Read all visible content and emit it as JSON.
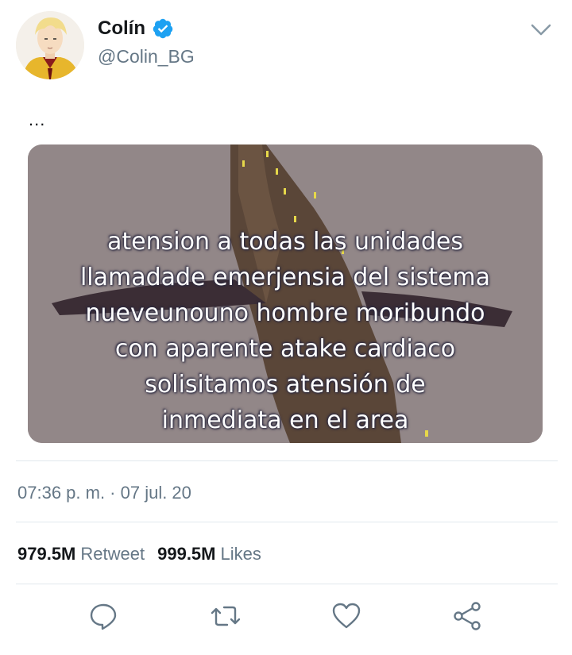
{
  "user": {
    "name": "Colín",
    "handle": "@Colin_BG"
  },
  "tweet": {
    "text": "...",
    "image_caption_lines": [
      "atension a todas las unidades",
      "llamadade emerjensia del sistema",
      "nueveunouno hombre moribundo",
      "con aparente atake cardiaco",
      "solisitamos atensión de",
      "inmediata en el area"
    ],
    "timestamp": "07:36 p. m. · 07 jul. 20"
  },
  "stats": {
    "retweets": "979.5M",
    "retweets_label": "Retweet",
    "likes": "999.5M",
    "likes_label": "Likes"
  },
  "icons": {
    "verified": "verified-badge-icon",
    "menu": "chevron-down-icon",
    "reply": "reply-icon",
    "retweet": "retweet-icon",
    "like": "heart-icon",
    "share": "share-icon"
  },
  "colors": {
    "accent": "#1da1f2",
    "text_primary": "#14171a",
    "text_secondary": "#657786",
    "divider": "#e1e8ed"
  }
}
